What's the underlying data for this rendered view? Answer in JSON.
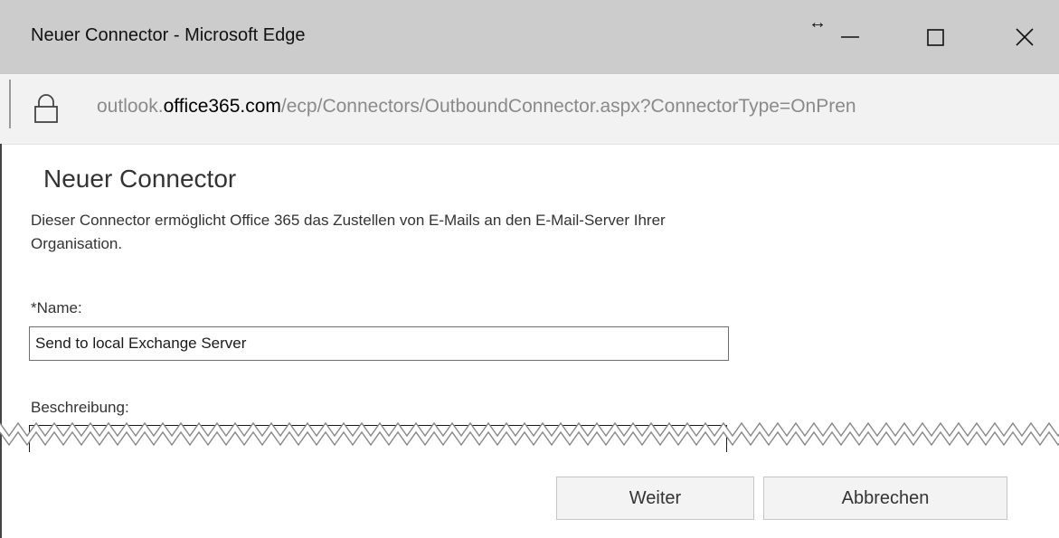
{
  "window": {
    "title": "Neuer Connector - Microsoft Edge",
    "resize_symbol": "↔"
  },
  "address_bar": {
    "url_prefix": "outlook.",
    "url_domain": "office365.com",
    "url_path": "/ecp/Connectors/OutboundConnector.aspx?ConnectorType=OnPren"
  },
  "form": {
    "heading": "Neuer Connector",
    "description": "Dieser Connector ermöglicht Office 365 das Zustellen von E-Mails an den E-Mail-Server Ihrer Organisation.",
    "name_label": "*Name:",
    "name_value": "Send to local Exchange Server",
    "description_label": "Beschreibung:"
  },
  "buttons": {
    "next": "Weiter",
    "cancel": "Abbrechen"
  },
  "colors": {
    "titlebar": "#cccccc",
    "addressbar": "#f2f2f2",
    "button_bg": "#f3f3f3"
  }
}
